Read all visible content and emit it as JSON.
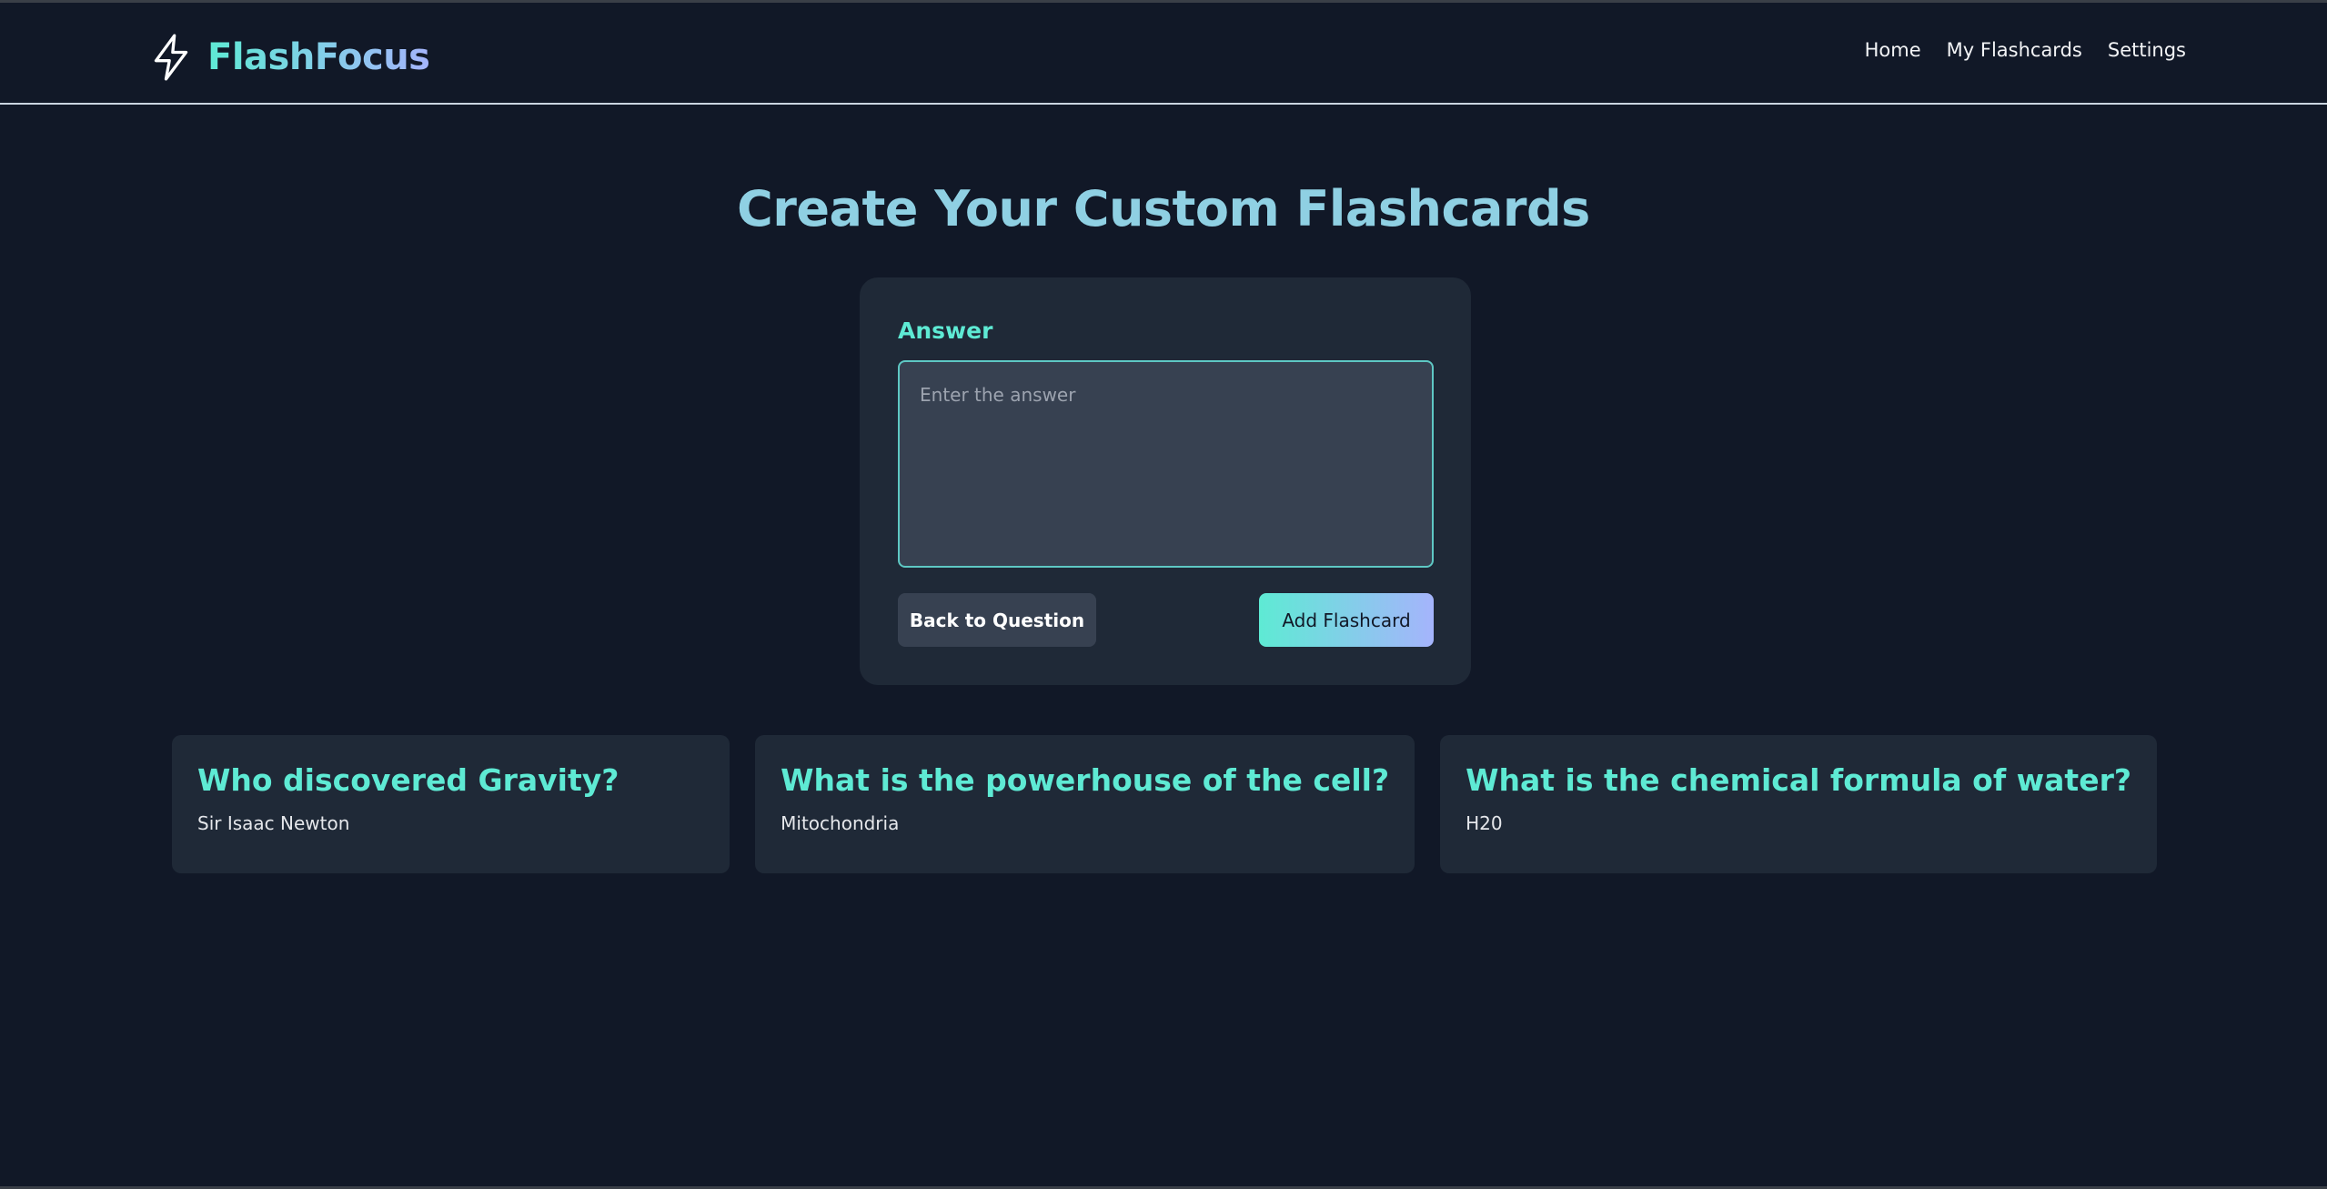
{
  "app": {
    "name": "FlashFocus",
    "logo_icon": "lightning-bolt-icon"
  },
  "nav": {
    "items": [
      {
        "label": "Home"
      },
      {
        "label": "My Flashcards"
      },
      {
        "label": "Settings"
      }
    ]
  },
  "main": {
    "title": "Create Your Custom Flashcards",
    "form": {
      "field_label": "Answer",
      "answer_value": "",
      "answer_placeholder": "Enter the answer",
      "back_label": "Back to Question",
      "add_label": "Add Flashcard"
    },
    "flashcards": [
      {
        "question": "Who discovered Gravity?",
        "answer": "Sir Isaac Newton"
      },
      {
        "question": "What is the powerhouse of the cell?",
        "answer": "Mitochondria"
      },
      {
        "question": "What is the chemical formula of water?",
        "answer": "H20"
      }
    ]
  },
  "colors": {
    "background": "#111827",
    "card": "#1f2937",
    "accent": "#5eead4",
    "accent_gradient_end": "#a5b4fc",
    "title": "#8fd0e3"
  }
}
